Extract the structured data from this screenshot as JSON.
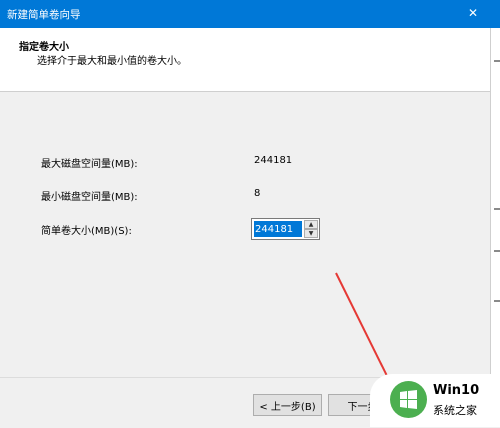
{
  "window": {
    "title": "新建简单卷向导",
    "close_symbol": "✕"
  },
  "header": {
    "title": "指定卷大小",
    "description": "选择介于最大和最小值的卷大小。"
  },
  "fields": {
    "max_label": "最大磁盘空间量(MB):",
    "max_value": "244181",
    "min_label": "最小磁盘空间量(MB):",
    "min_value": "8",
    "size_label": "简单卷大小(MB)(S):",
    "size_value": "244181"
  },
  "buttons": {
    "back": "< 上一步(B)",
    "next": "下一步"
  },
  "watermark": {
    "brand": "Win10",
    "sub": "系统之家"
  },
  "colors": {
    "titlebar": "#0078d7",
    "annotation": "#e53935",
    "logo": "#4caf50"
  }
}
